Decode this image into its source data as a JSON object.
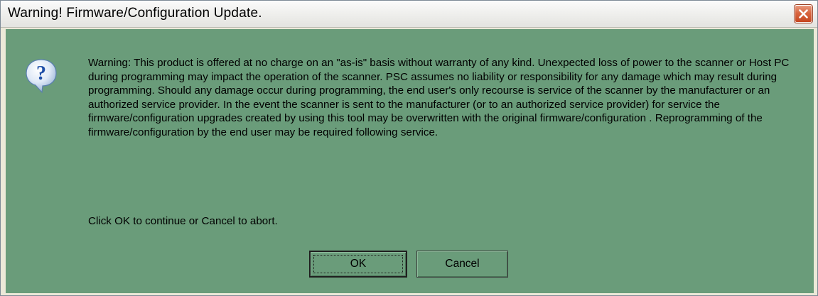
{
  "window": {
    "title": "Warning!  Firmware/Configuration Update."
  },
  "icons": {
    "close": "close-icon",
    "dialog": "question-icon"
  },
  "message": {
    "body": "Warning: This product is offered at no charge on an \"as-is\" basis without warranty of any kind.  Unexpected loss of power to the scanner or Host PC during programming may impact the operation of the scanner.  PSC assumes no liability or responsibility for any damage which may result during programming.  Should any damage occur during programming, the end user's only recourse is service of the scanner by the manufacturer or an authorized service provider.  In the event the scanner is sent to the manufacturer (or to an authorized service provider) for service the firmware/configuration upgrades created by using this tool may be overwritten with the original firmware/configuration .  Reprogramming of the firmware/configuration by the end user may be required following service.",
    "prompt": "Click OK to continue or Cancel to abort."
  },
  "buttons": {
    "ok_label": "OK",
    "cancel_label": "Cancel"
  },
  "colors": {
    "body_background": "#6a9c7a",
    "close_button": "#d8653f",
    "icon_bubble": "#3f7fd6"
  }
}
